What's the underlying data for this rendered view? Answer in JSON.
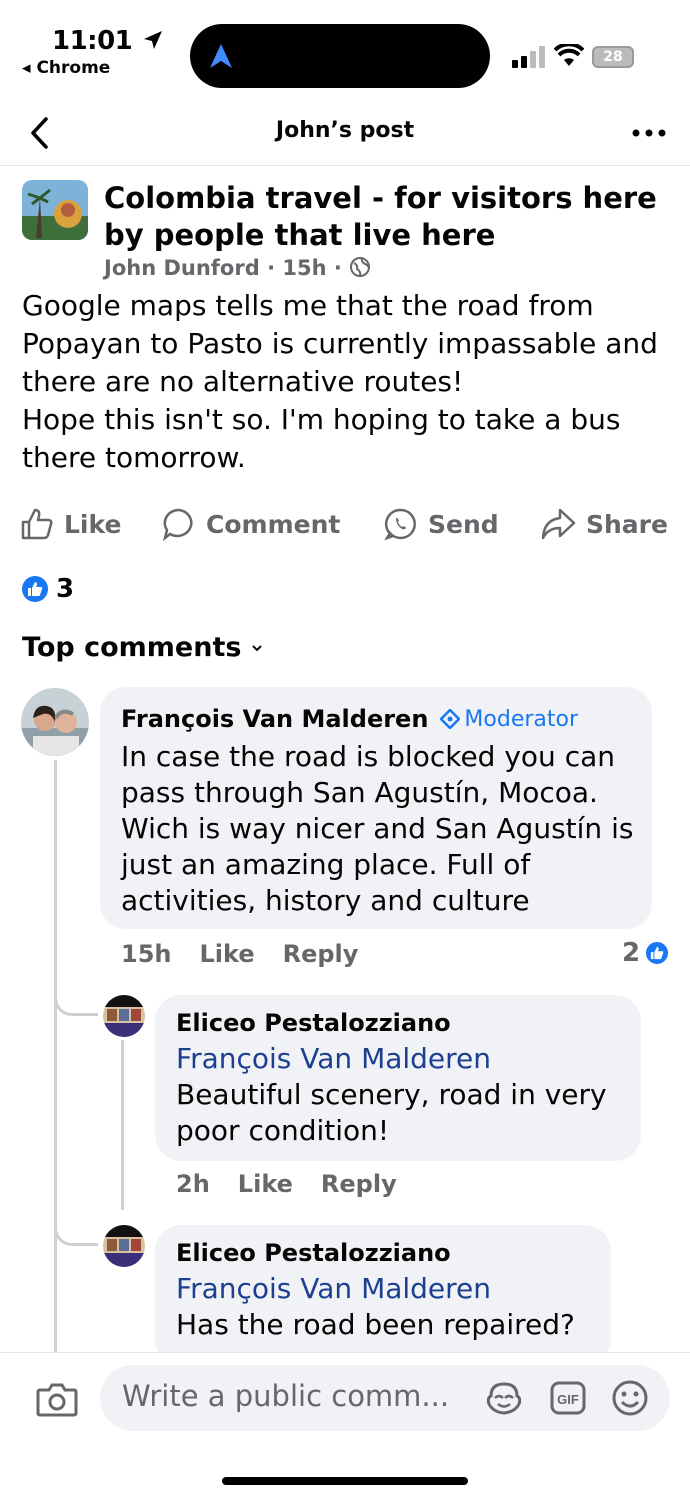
{
  "status_bar": {
    "time": "11:01",
    "back_app": "◂ Chrome",
    "battery": "28"
  },
  "header": {
    "title": "John’s post"
  },
  "post": {
    "group_name": "Colombia travel - for visitors here by people that live here",
    "author": "John Dunford",
    "age": "15h",
    "body_lines": [
      "Google maps tells me that the road from Popayan to Pasto is currently impassable and there are no alternative routes!",
      "Hope this isn't so. I'm hoping to take a bus there tomorrow."
    ],
    "actions": {
      "like": "Like",
      "comment": "Comment",
      "send": "Send",
      "share": "Share"
    },
    "reaction_count": "3"
  },
  "comments_section": {
    "title": "Top comments"
  },
  "comments": [
    {
      "author": "François Van Malderen",
      "badge": "Moderator",
      "text": "In case the road is blocked you can pass through San Agustín, Mocoa. Wich is way nicer and San Agustín is just an amazing place. Full of activities, history and culture",
      "age": "15h",
      "like": "Like",
      "reply": "Reply",
      "reaction_count": "2"
    },
    {
      "author": "Eliceo Pestalozziano",
      "mention": "François Van Malderen",
      "text": "Beautiful scenery, road in very poor condition!",
      "age": "2h",
      "like": "Like",
      "reply": "Reply"
    },
    {
      "author": "Eliceo Pestalozziano",
      "mention": "François Van Malderen",
      "text": "Has the road been repaired?"
    }
  ],
  "composer": {
    "placeholder": "Write a public comm..."
  },
  "colors": {
    "accent": "#1877f2",
    "mention": "#1d3f8f",
    "muted": "#65676b",
    "bubble": "#f0f2f5"
  }
}
